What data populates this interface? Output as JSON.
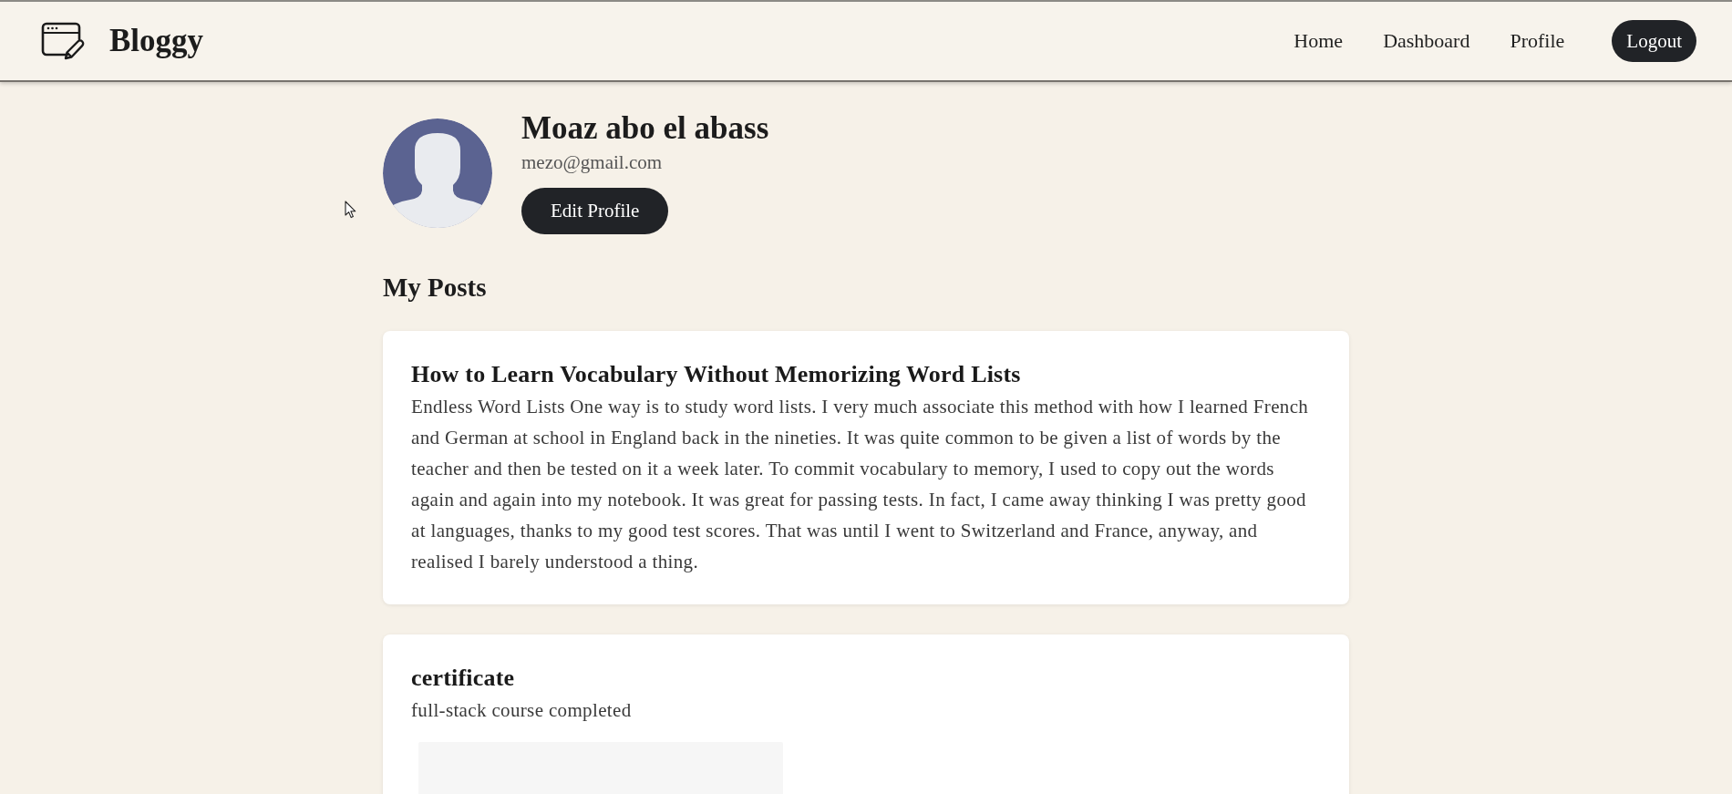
{
  "header": {
    "brand": "Bloggy",
    "nav_links": [
      "Home",
      "Dashboard",
      "Profile"
    ],
    "logout_button": "Logout"
  },
  "profile": {
    "name": "Moaz abo el abass",
    "email": "mezo@gmail.com",
    "edit_button": "Edit Profile"
  },
  "posts_section": {
    "heading": "My Posts",
    "posts": [
      {
        "title": "How to Learn Vocabulary Without Memorizing Word Lists",
        "body": "Endless Word Lists One way is to study word lists. I very much associate this method with how I learned French and German at school in England back in the nineties. It was quite common to be given a list of words by the teacher and then be tested on it a week later. To commit vocabulary to memory, I used to copy out the words again and again into my notebook. It was great for passing tests. In fact, I came away thinking I was pretty good at languages, thanks to my good test scores. That was until I went to Switzerland and France, anyway, and realised I barely understood a thing.",
        "has_image": false
      },
      {
        "title": "certificate",
        "body": "full-stack course completed",
        "has_image": true
      }
    ]
  }
}
